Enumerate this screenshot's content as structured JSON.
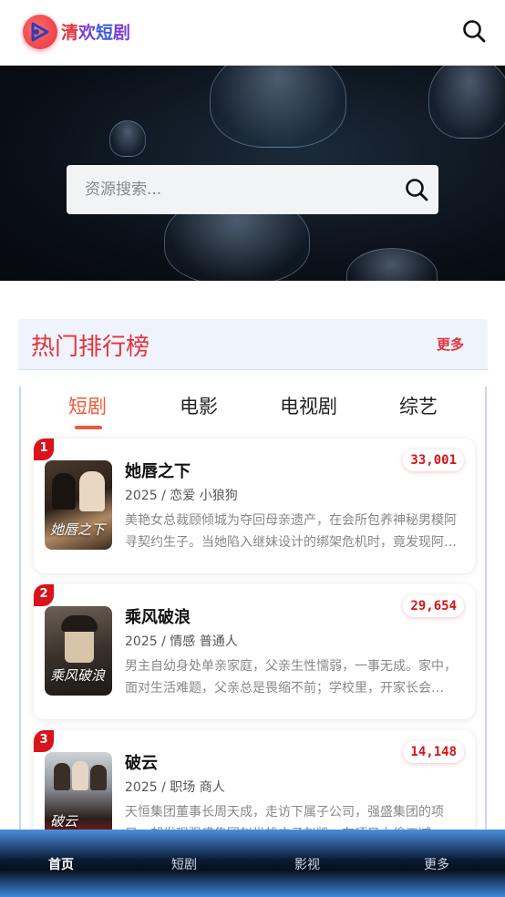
{
  "header": {
    "brand_chars": [
      "清",
      "欢",
      "短",
      "剧"
    ],
    "logo_icon": "play-logo-icon",
    "search_icon": "search-icon"
  },
  "hero": {
    "search_placeholder": "资源搜索...",
    "search_icon": "search-icon"
  },
  "ranking": {
    "title": "热门排行榜",
    "more_label": "更多",
    "tabs": [
      {
        "label": "短剧",
        "active": true
      },
      {
        "label": "电影",
        "active": false
      },
      {
        "label": "电视剧",
        "active": false
      },
      {
        "label": "综艺",
        "active": false
      }
    ],
    "items": [
      {
        "rank": "1",
        "title": "她唇之下",
        "meta": "2025 / 恋爱 小狼狗",
        "desc": "美艳女总裁顾倾城为夺回母亲遗产，在会所包养神秘男模阿寻契约生子。当她陷入继妹设计的绑架危机时，竟发现阿寻的真实身份……",
        "count": "33,001",
        "poster_text": "她唇之下"
      },
      {
        "rank": "2",
        "title": "乘风破浪",
        "meta": "2025 / 情感 普通人",
        "desc": "男主自幼身处单亲家庭，父亲生性懦弱，一事无成。家中，面对生活难题，父亲总是畏缩不前；学校里，开家长会时……",
        "count": "29,654",
        "poster_text": "乘风破浪"
      },
      {
        "rank": "3",
        "title": "破云",
        "meta": "2025 / 职场 商人",
        "desc": "天恒集团董事长周天成，走访下属子公司，强盛集团的项目，却发现强盛集团赵世雄之子赵凯，在项目上偷工减料……",
        "count": "14,148",
        "poster_text": "破云"
      }
    ]
  },
  "bottom_nav": [
    {
      "label": "首页",
      "active": true
    },
    {
      "label": "短剧",
      "active": false
    },
    {
      "label": "影视",
      "active": false
    },
    {
      "label": "更多",
      "active": false
    }
  ],
  "colors": {
    "accent_red": "#e8323c",
    "tab_active": "#ef5a3c",
    "badge_red": "#d9131a",
    "panel_bg": "#eef3fc"
  }
}
